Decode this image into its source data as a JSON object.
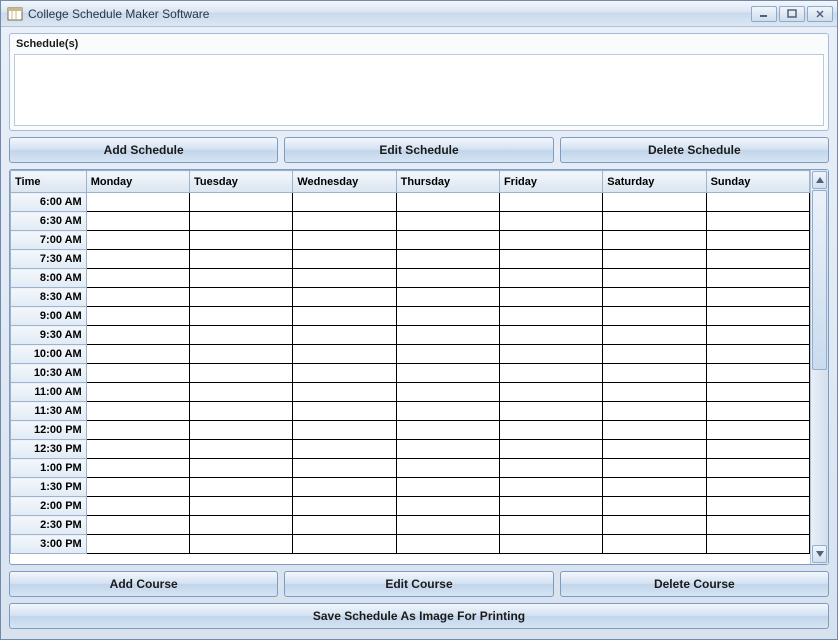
{
  "window": {
    "title": "College Schedule Maker Software"
  },
  "schedule_group": {
    "label": "Schedule(s)"
  },
  "schedule_buttons": {
    "add": "Add Schedule",
    "edit": "Edit Schedule",
    "delete": "Delete Schedule"
  },
  "grid": {
    "time_header": "Time",
    "days": [
      "Monday",
      "Tuesday",
      "Wednesday",
      "Thursday",
      "Friday",
      "Saturday",
      "Sunday"
    ],
    "times": [
      "6:00 AM",
      "6:30 AM",
      "7:00 AM",
      "7:30 AM",
      "8:00 AM",
      "8:30 AM",
      "9:00 AM",
      "9:30 AM",
      "10:00 AM",
      "10:30 AM",
      "11:00 AM",
      "11:30 AM",
      "12:00 PM",
      "12:30 PM",
      "1:00 PM",
      "1:30 PM",
      "2:00 PM",
      "2:30 PM",
      "3:00 PM"
    ]
  },
  "course_buttons": {
    "add": "Add Course",
    "edit": "Edit Course",
    "delete": "Delete Course"
  },
  "save_button": "Save Schedule As Image For Printing"
}
